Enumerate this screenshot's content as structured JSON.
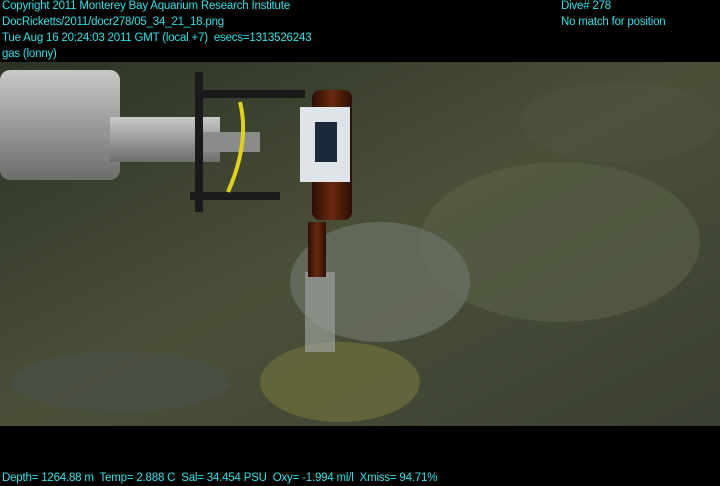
{
  "header": {
    "copyright": "Copyright 2011 Monterey Bay Aquarium Research Institute",
    "file_path": "DocRicketts/2011/docr278/05_34_21_18.png",
    "timestamp": "Tue Aug 16 20:24:03 2011 GMT (local +7)  esecs=1313526243",
    "camera": "gas (lonny)",
    "dive": "Dive# 278",
    "position_status": "No match for position"
  },
  "footer": {
    "telemetry": "Depth= 1264.88 m  Temp= 2.888 C  Sal= 34.454 PSU  Oxy= -1.994 ml/l  Xmiss= 94.71%"
  },
  "colors": {
    "overlay_text": "#2fe0e8",
    "background": "#000000"
  }
}
